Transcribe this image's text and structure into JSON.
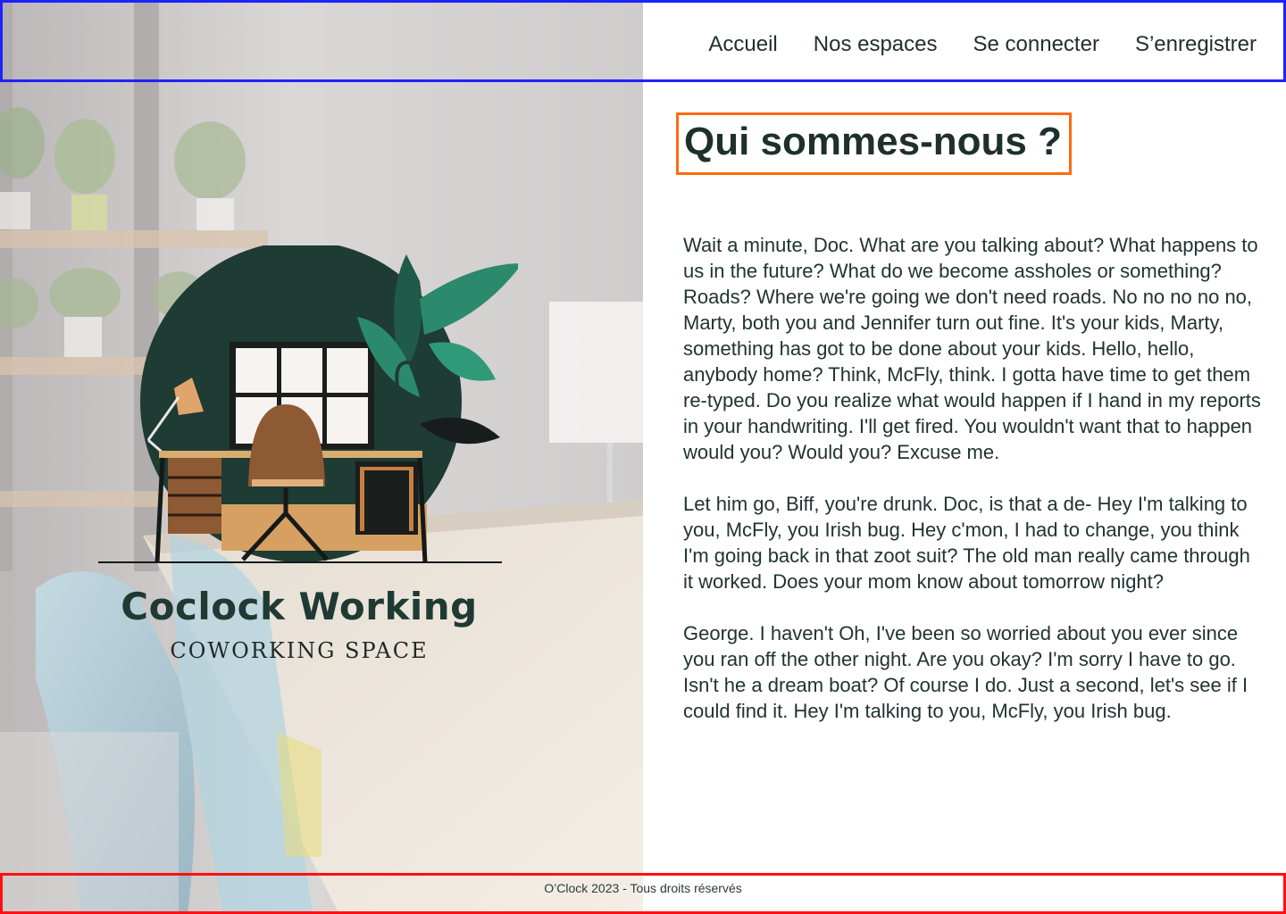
{
  "nav": {
    "items": [
      {
        "label": "Accueil"
      },
      {
        "label": "Nos espaces"
      },
      {
        "label": "Se connecter"
      },
      {
        "label": "S’enregistrer"
      }
    ]
  },
  "logo": {
    "name": "Coclock Working",
    "subtitle": "COWORKING SPACE"
  },
  "main": {
    "title": "Qui sommes-nous ?",
    "paragraphs": [
      "Wait a minute, Doc. What are you talking about? What happens to us in the future? What do we become assholes or something? Roads? Where we're going we don't need roads. No no no no no, Marty, both you and Jennifer turn out fine. It's your kids, Marty, something has got to be done about your kids. Hello, hello, anybody home? Think, McFly, think. I gotta have time to get them re-typed. Do you realize what would happen if I hand in my reports in your handwriting. I'll get fired. You wouldn't want that to happen would you? Would you? Excuse me.",
      "Let him go, Biff, you're drunk. Doc, is that a de- Hey I'm talking to you, McFly, you Irish bug. Hey c'mon, I had to change, you think I'm going back in that zoot suit? The old man really came through it worked. Does your mom know about tomorrow night?",
      "George. I haven't Oh, I've been so worried about you ever since you ran off the other night. Are you okay? I'm sorry I have to go. Isn't he a dream boat? Of course I do. Just a second, let's see if I could find it. Hey I'm talking to you, McFly, you Irish bug."
    ]
  },
  "footer": {
    "text": "O’Clock 2023 - Tous droits réservés"
  },
  "colors": {
    "header_border": "#1e22ff",
    "title_border": "#ff6a10",
    "footer_border": "#ff1010",
    "logo_dark_green": "#1f3a33"
  }
}
